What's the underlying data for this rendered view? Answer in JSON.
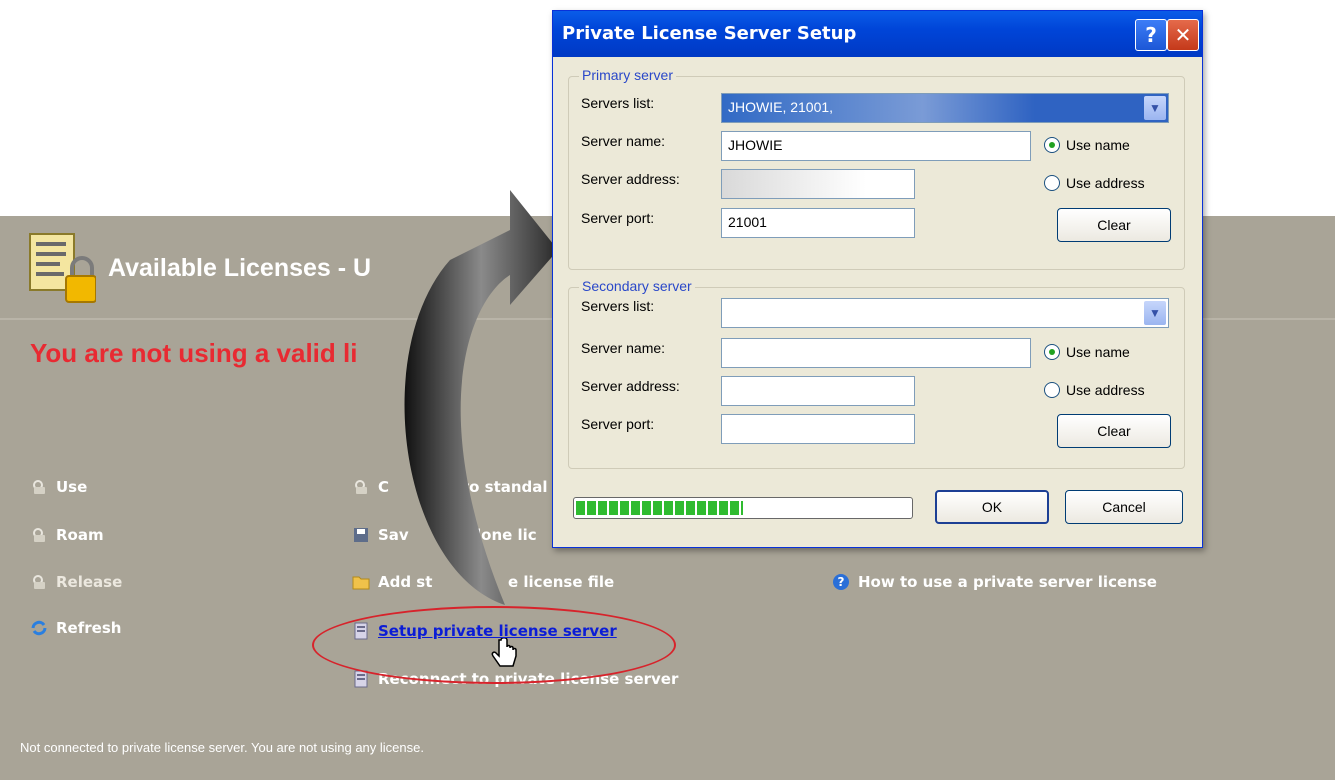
{
  "panel": {
    "title": "Available Licenses - U",
    "warning": "You are not using a valid li",
    "warning_tail": ".",
    "status": "Not connected to private license server. You are not using any license."
  },
  "actions_left": [
    {
      "label": "Use",
      "icon": "lock-icon"
    },
    {
      "label": "Roam",
      "icon": "lock-icon"
    },
    {
      "label": "Release",
      "icon": "lock-icon"
    },
    {
      "label": "Refresh",
      "icon": "refresh-icon"
    }
  ],
  "actions_mid": [
    {
      "label": "C",
      "icon": "lock-icon"
    },
    {
      "label": "Sav",
      "icon": "save-icon"
    },
    {
      "label": "Add st",
      "icon": "folder-icon"
    },
    {
      "label": "Setup private license server",
      "icon": "server-icon"
    },
    {
      "label": "Reconnect to private license server",
      "icon": "server-icon"
    }
  ],
  "actions_mid_tails": [
    "ert to standal",
    "lone lic",
    "e license file"
  ],
  "actions_right": [
    {
      "label": "How to use a private server license",
      "icon": "help-icon"
    }
  ],
  "dialog": {
    "title": "Private License Server Setup",
    "primary": {
      "group_label": "Primary server",
      "servers_list_label": "Servers list:",
      "servers_list_value": "JHOWIE, 21001,",
      "server_name_label": "Server name:",
      "server_name_value": "JHOWIE",
      "server_address_label": "Server address:",
      "server_address_value": "",
      "server_port_label": "Server port:",
      "server_port_value": "21001",
      "use_name": "Use name",
      "use_address": "Use address",
      "clear": "Clear",
      "selected_radio": "Use name"
    },
    "secondary": {
      "group_label": "Secondary server",
      "servers_list_label": "Servers list:",
      "servers_list_value": "",
      "server_name_label": "Server name:",
      "server_name_value": "",
      "server_address_label": "Server address:",
      "server_address_value": "",
      "server_port_label": "Server port:",
      "server_port_value": "",
      "use_name": "Use name",
      "use_address": "Use address",
      "clear": "Clear",
      "selected_radio": "Use name"
    },
    "progress_fraction": 0.5,
    "ok": "OK",
    "cancel": "Cancel",
    "help_glyph": "?",
    "close_glyph": "✕"
  },
  "colors": {
    "panel_bg": "#a9a497",
    "warning": "#e82a32",
    "link": "#0b1cd6",
    "titlebar": "#0045d8",
    "dialog_bg": "#ece9d8"
  }
}
